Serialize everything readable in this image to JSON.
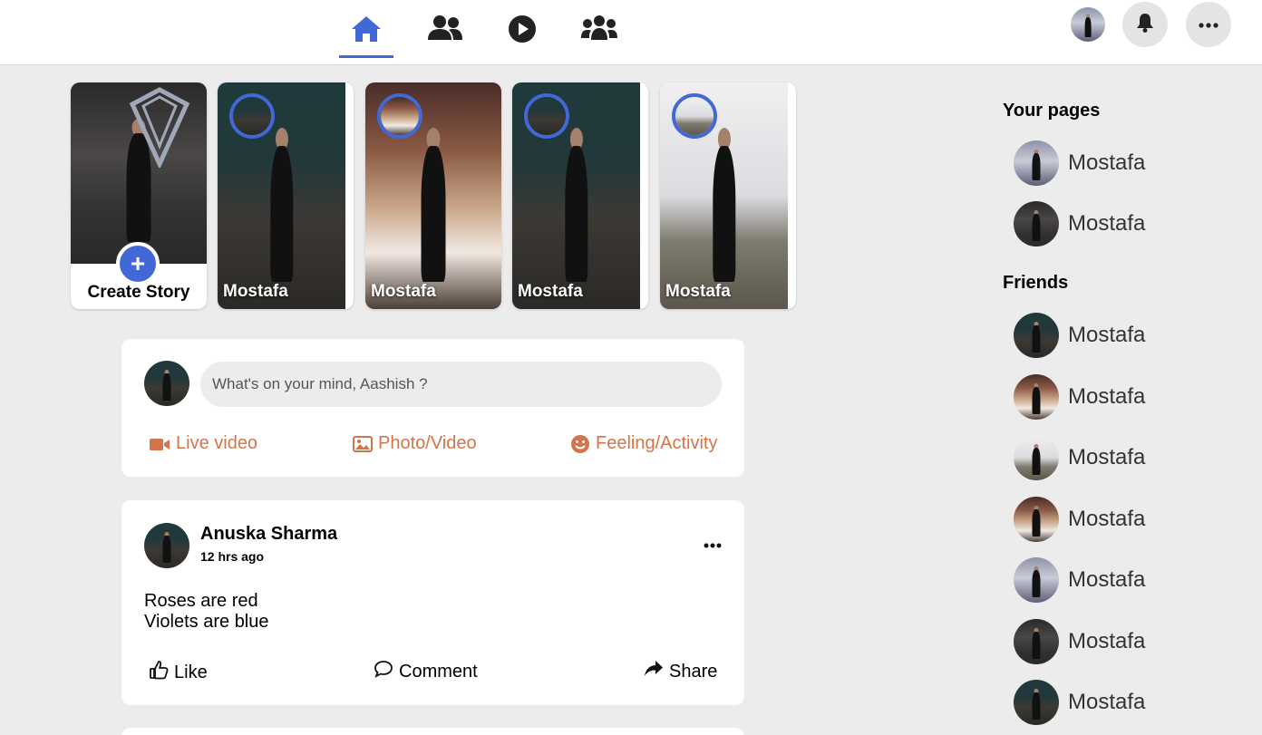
{
  "nav": {
    "icons": [
      "home-icon",
      "friends-icon",
      "watch-icon",
      "groups-icon"
    ],
    "active_index": 0,
    "accent_color": "#4267d6",
    "right": [
      "profile-avatar",
      "bell-icon",
      "more-icon"
    ]
  },
  "stories": {
    "create_label": "Create Story",
    "create_plus": "+",
    "items": [
      {
        "name": "Mostafa"
      },
      {
        "name": "Mostafa"
      },
      {
        "name": "Mostafa"
      },
      {
        "name": "Mostafa"
      }
    ]
  },
  "composer": {
    "placeholder": "What's on your mind, Aashish ?",
    "actions": {
      "live": "Live video",
      "photo": "Photo/Video",
      "feeling": "Feeling/Activity"
    },
    "action_color": "#d4744a"
  },
  "post": {
    "author": "Anuska Sharma",
    "time": "12 hrs ago",
    "lines": [
      "Roses are red",
      "Violets are blue"
    ],
    "actions": {
      "like": "Like",
      "comment": "Comment",
      "share": "Share"
    }
  },
  "sidebar": {
    "pages_heading": "Your pages",
    "pages": [
      {
        "name": "Mostafa"
      },
      {
        "name": "Mostafa"
      }
    ],
    "friends_heading": "Friends",
    "friends": [
      {
        "name": "Mostafa"
      },
      {
        "name": "Mostafa"
      },
      {
        "name": "Mostafa"
      },
      {
        "name": "Mostafa"
      },
      {
        "name": "Mostafa"
      },
      {
        "name": "Mostafa"
      },
      {
        "name": "Mostafa"
      }
    ]
  }
}
